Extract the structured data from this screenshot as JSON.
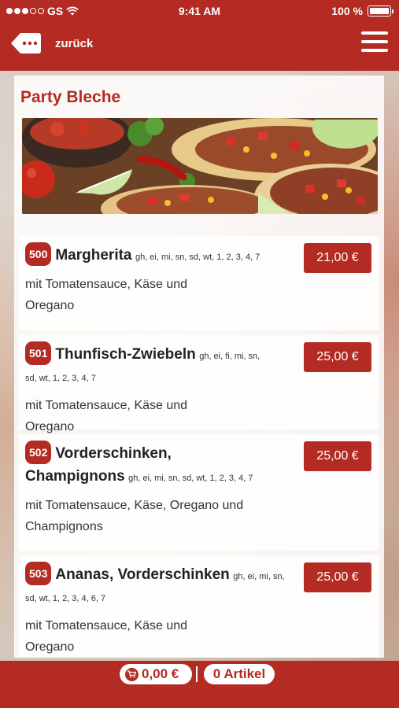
{
  "status_bar": {
    "carrier": "GS",
    "time": "9:41 AM",
    "battery": "100 %"
  },
  "header": {
    "back_label": "zurück",
    "back_icon": "tag-back-icon",
    "menu_icon": "hamburger-menu-icon"
  },
  "section": {
    "title": "Party Bleche"
  },
  "items": [
    {
      "number": "500",
      "name": "Margherita",
      "allergens": "gh, ei, mi, sn, sd, wt, 1, 2, 3, 4, 7",
      "description": "mit Tomatensauce, Käse und Oregano",
      "price": "21,00 €"
    },
    {
      "number": "501",
      "name": "Thunfisch-Zwiebeln",
      "allergens": "gh, ei, fi, mi, sn, sd, wt, 1, 2, 3, 4, 7",
      "description": "mit Tomatensauce, Käse und Oregano",
      "price": "25,00 €"
    },
    {
      "number": "502",
      "name": "Vorderschinken, Champignons",
      "allergens": "gh, ei, mi, sn, sd, wt, 1, 2, 3, 4, 7",
      "description": "mit Tomatensauce, Käse, Oregano und Champignons",
      "price": "25,00 €"
    },
    {
      "number": "503",
      "name": "Ananas, Vorderschinken",
      "allergens": "gh, ei, mi, sn, sd, wt, 1, 2, 3, 4, 6, 7",
      "description": "mit Tomatensauce, Käse und Oregano",
      "price": "25,00 €"
    }
  ],
  "footer": {
    "cart_total": "0,00 €",
    "article_count": "0 Artikel",
    "cart_icon": "cart-icon"
  },
  "colors": {
    "brand_red": "#b32b22"
  }
}
